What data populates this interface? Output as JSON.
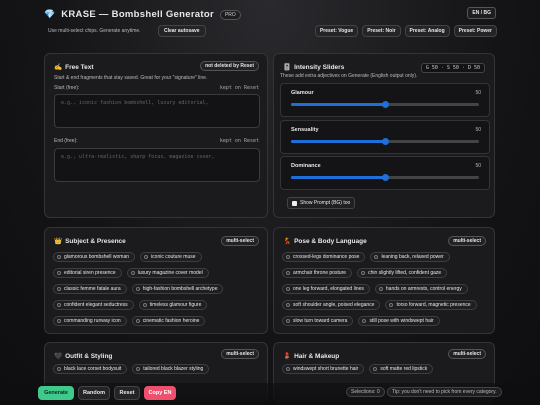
{
  "header": {
    "gem_icon": "💎",
    "title": "KRASE — Bombshell Generator",
    "badge": "PRO",
    "lang": "EN / BG",
    "subtitle": "Use multi-select chips. Generate anytime.",
    "clear_autosave": "Clear autosave",
    "presets": [
      "Preset: Vogue",
      "Preset: Noir",
      "Preset: Analog",
      "Preset: Power"
    ]
  },
  "free": {
    "icon": "✍️",
    "title": "Free Text",
    "tag": "not deleted by Reset",
    "desc": "Start & end fragments that stay saved. Great for your \"signature\" line.",
    "start_label": "Start (free):",
    "start_kept": "kept on Reset",
    "start_placeholder": "e.g., iconic fashion bombshell, luxury editorial,",
    "end_label": "End (free):",
    "end_kept": "kept on Reset",
    "end_placeholder": "e.g., ultra-realistic, sharp focus, magazine cover,"
  },
  "intensity": {
    "icon": "🎚️",
    "title": "Intensity Sliders",
    "ratio": "G 50 · S 50 · D 50",
    "desc": "These add extra adjectives on Generate (English output only).",
    "sliders": [
      {
        "name": "Glamour",
        "value": 50
      },
      {
        "name": "Sensuality",
        "value": 50
      },
      {
        "name": "Dominance",
        "value": 50
      }
    ],
    "show_prompt": "Show Prompt (BG) too"
  },
  "subject": {
    "icon": "👑",
    "title": "Subject & Presence",
    "tag": "multi-select",
    "chips": [
      "glamorous bombshell woman",
      "iconic couture muse",
      "editorial siren presence",
      "luxury magazine cover model",
      "classic femme fatale aura",
      "high-fashion bombshell archetype",
      "confident elegant seductress",
      "timeless glamour figure",
      "commanding runway icon",
      "cinematic fashion heroine"
    ]
  },
  "pose": {
    "icon": "💃",
    "title": "Pose & Body Language",
    "tag": "multi-select",
    "chips": [
      "crossed-legs dominance pose",
      "leaning back, relaxed power",
      "armchair throne posture",
      "chin slightly lifted, confident gaze",
      "one leg forward, elongated lines",
      "hands on armrests, control energy",
      "soft shoulder angle, poised elegance",
      "torso forward, magnetic presence",
      "slow turn toward camera",
      "still pose with windswept hair"
    ]
  },
  "outfit": {
    "icon": "🖤",
    "title": "Outfit & Styling",
    "tag": "multi-select",
    "chips": [
      "black lace corset bodysuit",
      "tailored black blazer styling"
    ]
  },
  "hair": {
    "icon": "💄",
    "title": "Hair & Makeup",
    "tag": "multi-select",
    "chips": [
      "windswept short brunette hair",
      "soft matte red lipstick"
    ]
  },
  "footer": {
    "generate": "Generate",
    "random": "Random",
    "reset": "Reset",
    "copy": "Copy EN",
    "selections": "Selections: 0",
    "tip": "Tip: you don't need to pick from every category."
  },
  "colors": {
    "accent": "#1e6fd9",
    "generate": "#3fc98a",
    "copy": "#f0506e"
  }
}
